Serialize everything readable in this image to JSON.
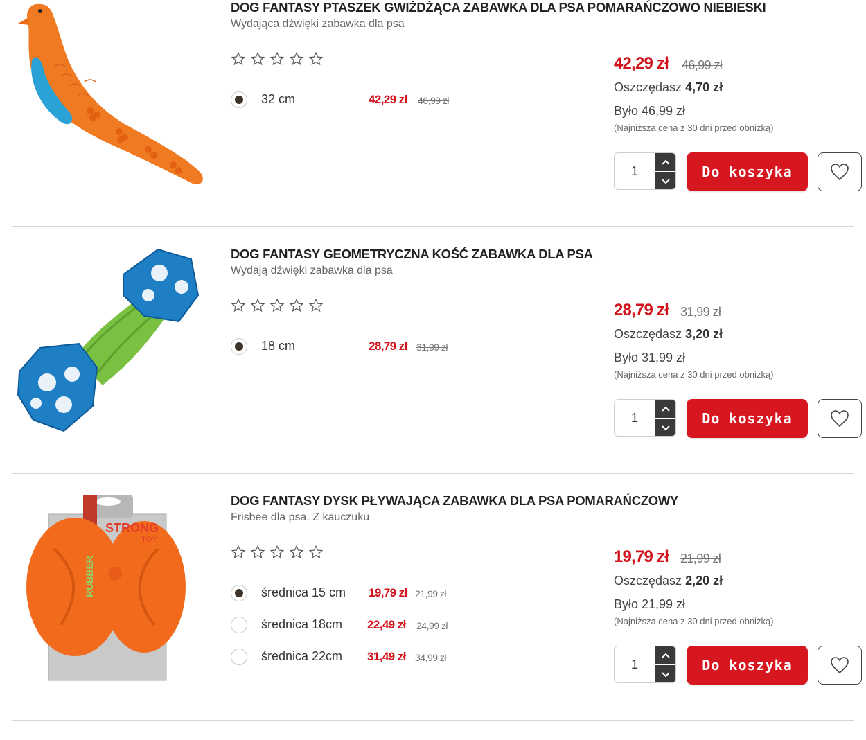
{
  "colors": {
    "price_red": "#d1131c",
    "cart_button": "#d7171f",
    "radio_fill": "#3d3227"
  },
  "icons": {
    "star": "star-outline-icon",
    "heart": "heart-outline-icon",
    "up": "chevron-up-icon",
    "down": "chevron-down-icon"
  },
  "products": [
    {
      "title": "DOG FANTASY PTASZEK GWIŻDŻĄCA ZABAWKA DLA PSA POMARAŃCZOWO NIEBIESKI",
      "subtitle": "Wydająca dźwięki zabawka dla psa",
      "rating": 0,
      "variants": [
        {
          "label": "32 cm",
          "price": "42,29 zł",
          "old_price": "46,99 zł",
          "selected": true
        }
      ],
      "price": "42,29 zł",
      "old_price": "46,99 zł",
      "save_label": "Oszczędasz",
      "save_value": "4,70 zł",
      "was": "Było 46,99 zł",
      "lowest": "(Najniższa cena z 30 dni przed obniżką)",
      "quantity": "1",
      "cart_label": "Do koszyka"
    },
    {
      "title": "DOG FANTASY GEOMETRYCZNA KOŚĆ ZABAWKA DLA PSA",
      "subtitle": "Wydają dźwięki zabawka dla psa",
      "rating": 0,
      "variants": [
        {
          "label": "18 cm",
          "price": "28,79 zł",
          "old_price": "31,99 zł",
          "selected": true
        }
      ],
      "price": "28,79 zł",
      "old_price": "31,99 zł",
      "save_label": "Oszczędasz",
      "save_value": "3,20 zł",
      "was": "Było 31,99 zł",
      "lowest": "(Najniższa cena z 30 dni przed obniżką)",
      "quantity": "1",
      "cart_label": "Do koszyka"
    },
    {
      "title": "DOG FANTASY DYSK PŁYWAJĄCA ZABAWKA DLA PSA POMARAŃCZOWY",
      "subtitle": "Frisbee dla psa. Z kauczuku",
      "rating": 0,
      "variants": [
        {
          "label": "średnica 15 cm",
          "price": "19,79 zł",
          "old_price": "21,99 zł",
          "selected": true
        },
        {
          "label": "średnica 18cm",
          "price": "22,49 zł",
          "old_price": "24,99 zł",
          "selected": false
        },
        {
          "label": "średnica 22cm",
          "price": "31,49 zł",
          "old_price": "34,99 zł",
          "selected": false
        }
      ],
      "price": "19,79 zł",
      "old_price": "21,99 zł",
      "save_label": "Oszczędasz",
      "save_value": "2,20 zł",
      "was": "Było 21,99 zł",
      "lowest": "(Najniższa cena z 30 dni przed obniżką)",
      "quantity": "1",
      "cart_label": "Do koszyka",
      "package_text": [
        "STRONG",
        "TOY",
        "RUBBER"
      ]
    }
  ]
}
